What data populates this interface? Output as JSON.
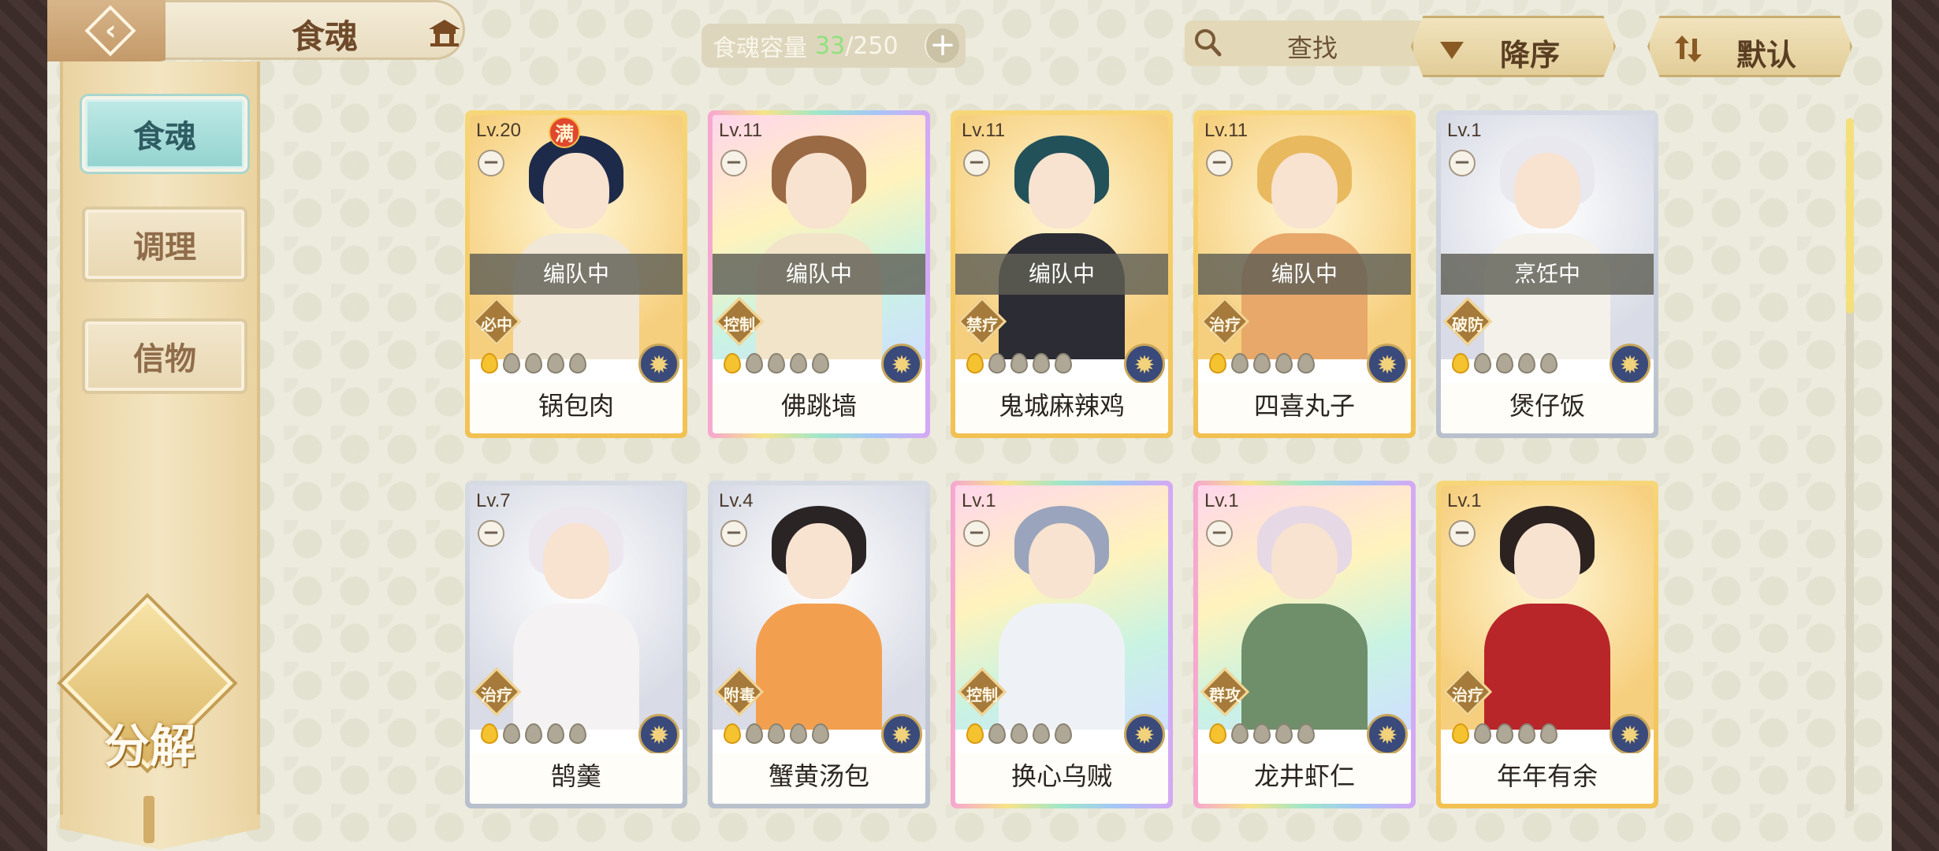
{
  "header": {
    "title": "食魂",
    "capacity_label": "食魂容量",
    "capacity_current": "33",
    "capacity_max": "/250",
    "search_placeholder": "查找",
    "sort_label": "降序",
    "default_label": "默认"
  },
  "sidebar": {
    "tabs": [
      {
        "label": "食魂",
        "active": true
      },
      {
        "label": "调理",
        "active": false
      },
      {
        "label": "信物",
        "active": false
      }
    ],
    "decompose_label": "分解"
  },
  "cards": [
    {
      "level": "Lv.20",
      "full": "满",
      "status": "编队中",
      "role": "必中",
      "lit_flames": 1,
      "name": "锅包肉",
      "frame": "gold",
      "hair": "#1e2a4a",
      "body": "#f1e7d6"
    },
    {
      "level": "Lv.11",
      "full": "",
      "status": "编队中",
      "role": "控制",
      "lit_flames": 1,
      "name": "佛跳墙",
      "frame": "rainbow",
      "hair": "#9a6a44",
      "body": "#f2e4c8"
    },
    {
      "level": "Lv.11",
      "full": "",
      "status": "编队中",
      "role": "禁疗",
      "lit_flames": 1,
      "name": "鬼城麻辣鸡",
      "frame": "gold",
      "hair": "#22515a",
      "body": "#2c2c34"
    },
    {
      "level": "Lv.11",
      "full": "",
      "status": "编队中",
      "role": "治疗",
      "lit_flames": 1,
      "name": "四喜丸子",
      "frame": "gold",
      "hair": "#e8b95e",
      "body": "#e8a86a"
    },
    {
      "level": "Lv.1",
      "full": "",
      "status": "烹饪中",
      "role": "破防",
      "lit_flames": 1,
      "name": "煲仔饭",
      "frame": "silver",
      "hair": "#e8e8ee",
      "body": "#f3f1ea"
    },
    {
      "level": "Lv.7",
      "full": "",
      "status": "",
      "role": "治疗",
      "lit_flames": 1,
      "name": "鹄羹",
      "frame": "silver",
      "hair": "#ece7ee",
      "body": "#f4f2f2"
    },
    {
      "level": "Lv.4",
      "full": "",
      "status": "",
      "role": "附毒",
      "lit_flames": 1,
      "name": "蟹黄汤包",
      "frame": "silver",
      "hair": "#2a2424",
      "body": "#f2a050"
    },
    {
      "level": "Lv.1",
      "full": "",
      "status": "",
      "role": "控制",
      "lit_flames": 1,
      "name": "换心乌贼",
      "frame": "rainbow",
      "hair": "#9aa4bc",
      "body": "#eef2f6"
    },
    {
      "level": "Lv.1",
      "full": "",
      "status": "",
      "role": "群攻",
      "lit_flames": 1,
      "name": "龙井虾仁",
      "frame": "rainbow",
      "hair": "#e6d8e4",
      "body": "#6f8f6a"
    },
    {
      "level": "Lv.1",
      "full": "",
      "status": "",
      "role": "治疗",
      "lit_flames": 1,
      "name": "年年有余",
      "frame": "gold",
      "hair": "#2c2220",
      "body": "#b8262a"
    }
  ],
  "icons": {
    "back": "back-arrow-icon",
    "house": "pavilion-icon",
    "search": "search-icon",
    "close": "close-icon",
    "sort": "sort-down-icon",
    "default": "sort-toggle-icon"
  }
}
